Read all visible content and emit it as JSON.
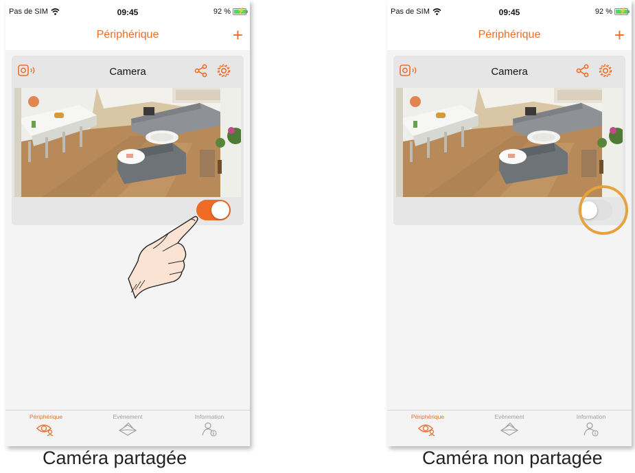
{
  "accent_color": "#ee6c25",
  "highlight_color": "#e6a23c",
  "status_bar": {
    "carrier": "Pas de SIM",
    "time": "09:45",
    "battery": "92 %",
    "battery_level": 0.92
  },
  "nav": {
    "title": "Périphérique",
    "add_label": "+"
  },
  "card": {
    "title": "Camera",
    "icons": [
      "camera-sound-icon",
      "share-icon",
      "gear-icon"
    ]
  },
  "tabs": [
    {
      "label": "Périphérique",
      "icon": "device-eye-icon",
      "active": true
    },
    {
      "label": "Evènement",
      "icon": "envelope-icon",
      "active": false
    },
    {
      "label": "Information",
      "icon": "user-info-icon",
      "active": false
    }
  ],
  "left_screen": {
    "share_toggle": "on",
    "caption": "Caméra partagée"
  },
  "right_screen": {
    "share_toggle": "off",
    "caption": "Caméra non partagée"
  }
}
